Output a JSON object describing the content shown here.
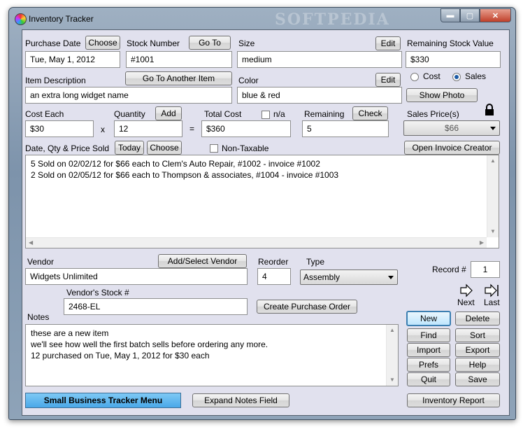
{
  "window": {
    "title": "Inventory Tracker",
    "watermark": "SOFTPEDIA",
    "min_glyph": "▬",
    "max_glyph": "▢",
    "close_glyph": "✕"
  },
  "purchase": {
    "label": "Purchase Date",
    "choose": "Choose",
    "value": "Tue, May 1, 2012"
  },
  "stock": {
    "label": "Stock Number",
    "goto": "Go To",
    "value": "#1001",
    "goto_another": "Go To Another Item"
  },
  "size": {
    "label": "Size",
    "edit": "Edit",
    "value": "medium"
  },
  "remaining_value": {
    "label": "Remaining Stock Value",
    "value": "$330",
    "radio_cost": "Cost",
    "radio_sales": "Sales",
    "selected": "Sales"
  },
  "description": {
    "label": "Item Description",
    "value": "an extra long widget name"
  },
  "color": {
    "label": "Color",
    "edit": "Edit",
    "value": "blue & red"
  },
  "show_photo": "Show Photo",
  "cost_each": {
    "label": "Cost Each",
    "value": "$30"
  },
  "quantity": {
    "label": "Quantity",
    "add": "Add",
    "value": "12"
  },
  "total_cost": {
    "label": "Total Cost",
    "na": "n/a",
    "value": "$360"
  },
  "remaining": {
    "label": "Remaining",
    "check": "Check",
    "value": "5"
  },
  "ops": {
    "x": "x",
    "eq": "="
  },
  "sales_price": {
    "label": "Sales Price(s)",
    "value": "$66"
  },
  "sold": {
    "label": "Date, Qty & Price Sold",
    "today": "Today",
    "choose": "Choose",
    "non_taxable": "Non-Taxable",
    "invoice_creator": "Open Invoice Creator",
    "lines": [
      "5 Sold on 02/02/12 for $66 each to Clem's Auto Repair, #1002 - invoice #1002",
      "2 Sold on 02/05/12 for $66 each to Thompson & associates, #1004 - invoice #1003"
    ]
  },
  "vendor": {
    "label": "Vendor",
    "add_select": "Add/Select Vendor",
    "value": "Widgets Unlimited",
    "stock_label": "Vendor's Stock #",
    "stock_value": "2468-EL",
    "create_po": "Create Purchase Order"
  },
  "reorder": {
    "label": "Reorder",
    "value": "4"
  },
  "type": {
    "label": "Type",
    "value": "Assembly"
  },
  "record": {
    "label": "Record #",
    "value": "1",
    "next": "Next",
    "last": "Last"
  },
  "notes": {
    "label": "Notes",
    "lines": [
      "these are a new item",
      "we'll see how well the first batch sells before ordering any more.",
      "12 purchased on Tue, May 1, 2012 for $30 each"
    ]
  },
  "actions": {
    "new": "New",
    "delete": "Delete",
    "find": "Find",
    "sort": "Sort",
    "import": "Import",
    "export": "Export",
    "prefs": "Prefs",
    "help": "Help",
    "quit": "Quit",
    "save": "Save"
  },
  "footer": {
    "menu": "Small Business Tracker Menu",
    "expand_notes": "Expand Notes Field",
    "inventory_report": "Inventory Report"
  },
  "scroll": {
    "up": "▲",
    "down": "▼",
    "left": "◀",
    "right": "▶"
  },
  "colors": {
    "panel": "#e1e1ee",
    "menu_button": "#4aa8e8",
    "titlebar": "#8ea3b8"
  }
}
